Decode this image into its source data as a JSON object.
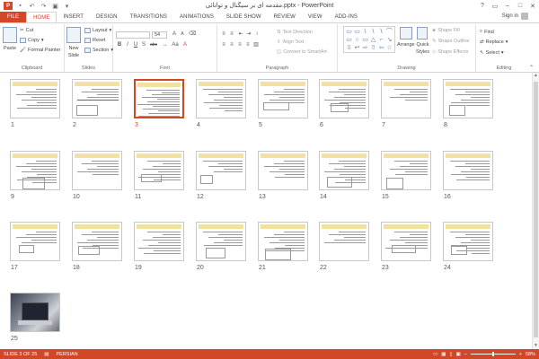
{
  "window": {
    "title": "مقدمه ای بر سیگنال و توانائی.pptx - PowerPoint",
    "controls": [
      "?",
      "▭",
      "–",
      "□",
      "✕"
    ],
    "app_logo": "P"
  },
  "qat": [
    "save-icon",
    "undo-icon",
    "redo-icon",
    "present-icon",
    "customize-icon"
  ],
  "tabs": [
    {
      "label": "FILE"
    },
    {
      "label": "HOME"
    },
    {
      "label": "INSERT"
    },
    {
      "label": "DESIGN"
    },
    {
      "label": "TRANSITIONS"
    },
    {
      "label": "ANIMATIONS"
    },
    {
      "label": "SLIDE SHOW"
    },
    {
      "label": "REVIEW"
    },
    {
      "label": "VIEW"
    },
    {
      "label": "ADD-INS"
    }
  ],
  "signin": "Sign in",
  "ribbon": {
    "clipboard": {
      "label": "Clipboard",
      "paste": "Paste",
      "cut": "Cut",
      "copy": "Copy",
      "format_painter": "Format Painter"
    },
    "slides": {
      "label": "Slides",
      "new_slide": "New",
      "new_slide2": "Slide",
      "layout": "Layout",
      "reset": "Reset",
      "section": "Section"
    },
    "font": {
      "label": "Font",
      "size": "54",
      "bold": "B",
      "italic": "I",
      "underline": "U",
      "shadow": "S",
      "strike": "abc",
      "aa": "Aa",
      "grow": "A",
      "shrink": "A"
    },
    "paragraph": {
      "label": "Paragraph",
      "text_direction": "Text Direction",
      "align_text": "Align Text",
      "smartart": "Convert to SmartArt"
    },
    "drawing": {
      "label": "Drawing",
      "arrange": "Arrange",
      "quick_styles": "Quick",
      "quick_styles2": "Styles",
      "shape_fill": "Shape Fill",
      "shape_outline": "Shape Outline",
      "shape_effects": "Shape Effects",
      "shapes": [
        "▭",
        "▭",
        "\\",
        "\\",
        "\\",
        "⌒",
        "▭",
        "○",
        "▭",
        "△",
        "⌐",
        "↘",
        "⇩",
        "↩",
        "⇨",
        "⇧",
        "⇦",
        "☆"
      ]
    },
    "editing": {
      "label": "Editing",
      "find": "Find",
      "replace": "Replace",
      "select": "Select"
    }
  },
  "slides": [
    {
      "n": "1"
    },
    {
      "n": "2"
    },
    {
      "n": "3",
      "selected": true
    },
    {
      "n": "4"
    },
    {
      "n": "5"
    },
    {
      "n": "6"
    },
    {
      "n": "7"
    },
    {
      "n": "8"
    },
    {
      "n": "9"
    },
    {
      "n": "10"
    },
    {
      "n": "11"
    },
    {
      "n": "12"
    },
    {
      "n": "13"
    },
    {
      "n": "14"
    },
    {
      "n": "15"
    },
    {
      "n": "16"
    },
    {
      "n": "17"
    },
    {
      "n": "18"
    },
    {
      "n": "19"
    },
    {
      "n": "20"
    },
    {
      "n": "21"
    },
    {
      "n": "22"
    },
    {
      "n": "23"
    },
    {
      "n": "24"
    },
    {
      "n": "25",
      "photo": true
    }
  ],
  "status": {
    "slide": "SLIDE 3 OF 25",
    "language": "PERSIAN",
    "zoom": "58%"
  },
  "colors": {
    "accent": "#d24726"
  }
}
